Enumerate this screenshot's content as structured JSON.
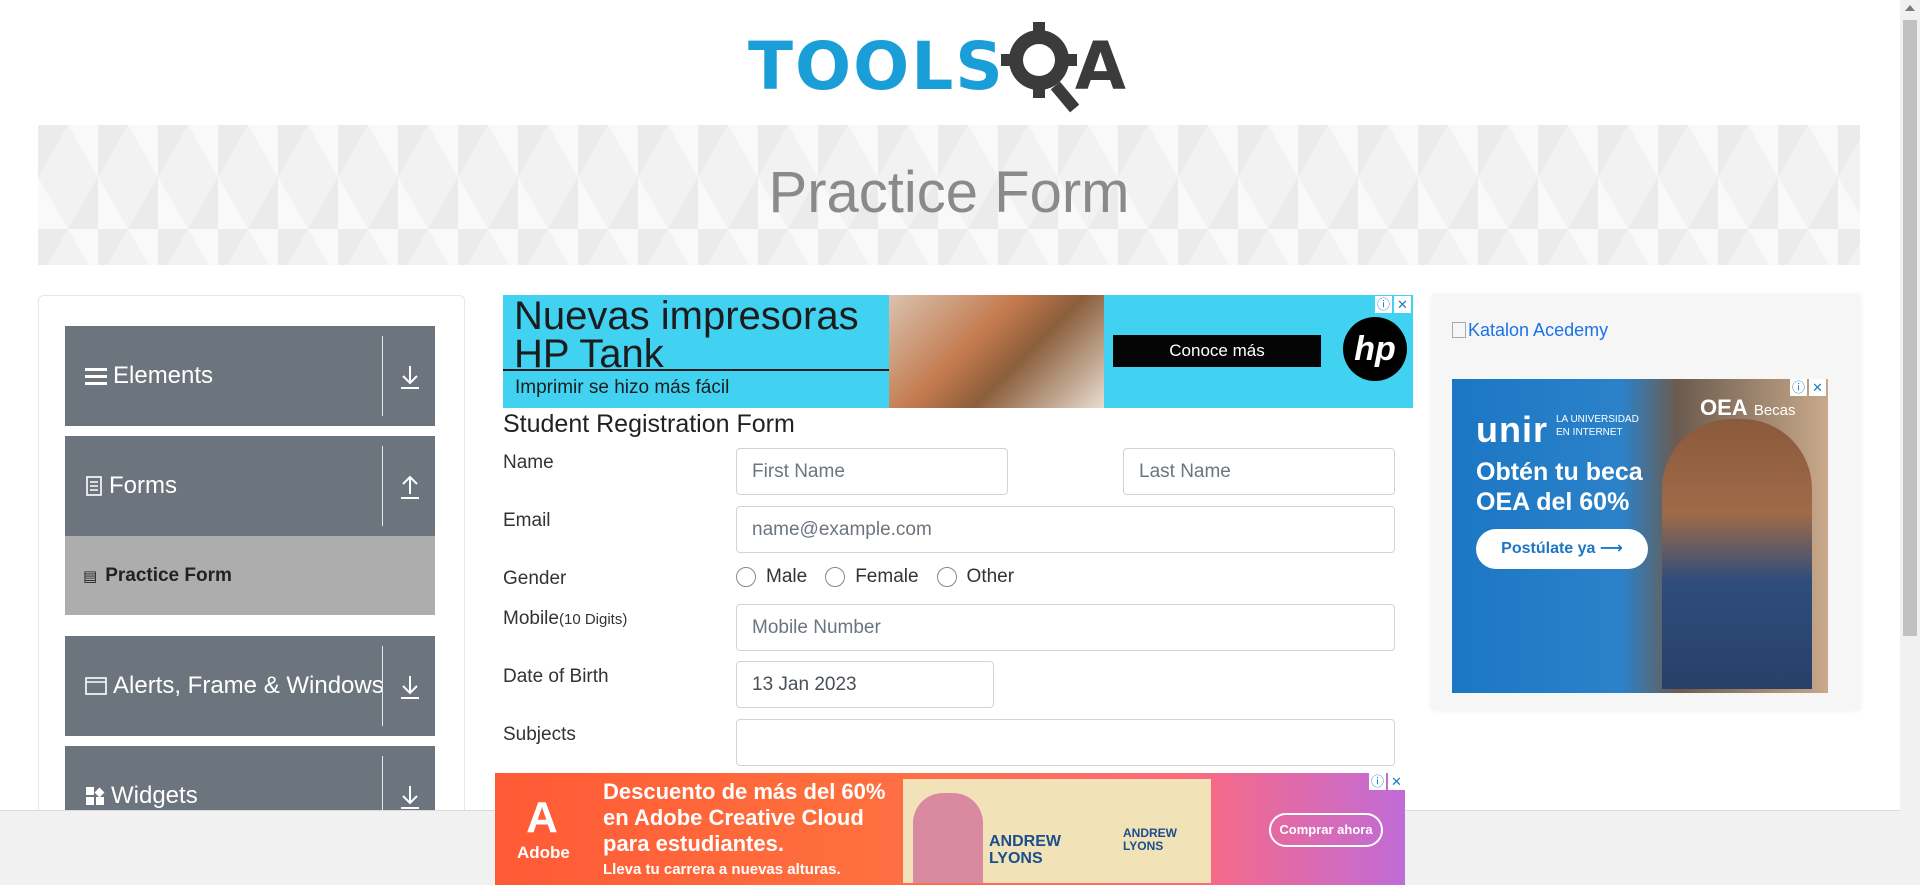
{
  "logo": {
    "text_left": "TOOLS",
    "text_right": "A"
  },
  "banner": {
    "title": "Practice Form"
  },
  "sidebar": {
    "groups": [
      {
        "label": "Elements",
        "icon": "menu-icon",
        "state": "collapsed"
      },
      {
        "label": "Forms",
        "icon": "document-icon",
        "state": "expanded"
      },
      {
        "label": "Alerts, Frame & Windows",
        "icon": "window-icon",
        "state": "collapsed"
      },
      {
        "label": "Widgets",
        "icon": "grid-icon",
        "state": "collapsed"
      }
    ],
    "active_item": {
      "label": "Practice Form",
      "icon": "form-icon"
    }
  },
  "top_ad": {
    "headline": "Nuevas impresoras HP Tank",
    "subline": "Imprimir se hizo más fácil",
    "cta": "Conoce más",
    "brand": "hp",
    "close": "✕",
    "info": "ⓘ"
  },
  "form": {
    "title": "Student Registration Form",
    "name_label": "Name",
    "first_name_placeholder": "First Name",
    "last_name_placeholder": "Last Name",
    "email_label": "Email",
    "email_placeholder": "name@example.com",
    "gender_label": "Gender",
    "gender_options": [
      "Male",
      "Female",
      "Other"
    ],
    "mobile_label": "Mobile",
    "mobile_hint": "(10 Digits)",
    "mobile_placeholder": "Mobile Number",
    "dob_label": "Date of Birth",
    "dob_value": "13 Jan 2023",
    "subjects_label": "Subjects",
    "subjects_value": ""
  },
  "right_ad": {
    "alt_link": "Katalon Acedemy",
    "brand": "unir",
    "brand_sub": "LA UNIVERSIDAD EN INTERNET",
    "partner": "OEA",
    "partner_sub": "Becas",
    "headline_1": "Obtén tu beca",
    "headline_2": "OEA del 60%",
    "cta": "Postúlate ya ⟶",
    "close": "✕",
    "info": "ⓘ"
  },
  "bottom_ad": {
    "brand": "Adobe",
    "headline_1": "Descuento de más del 60%",
    "headline_2": "en Adobe Creative Cloud",
    "headline_3": "para estudiantes.",
    "subline": "Lleva tu carrera a nuevas alturas.",
    "poster_name_1": "ANDREW LYONS",
    "poster_name_2": "ANDREW LYONS",
    "cta": "Comprar ahora",
    "close": "✕",
    "info": "ⓘ"
  },
  "colors": {
    "logo_blue": "#1a9ed8",
    "sidebar_group": "#6c757d",
    "sidebar_active": "#adadad",
    "hp_ad_bg": "#41d2f2"
  }
}
